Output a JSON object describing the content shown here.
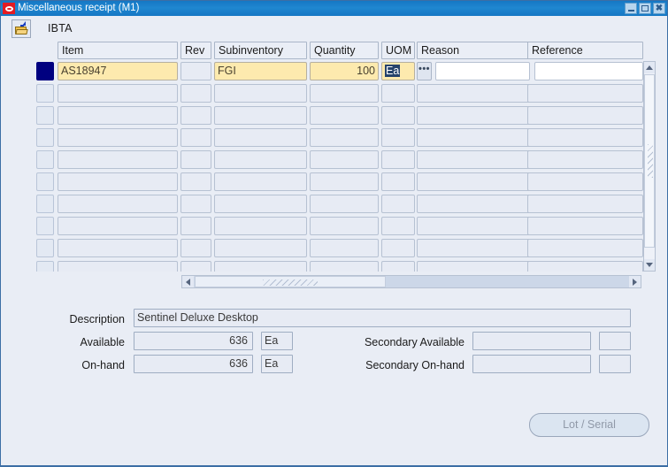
{
  "window": {
    "title": "Miscellaneous receipt (M1)",
    "logo_icon": "oracle-logo-icon",
    "controls": {
      "minimize": "minimize-icon",
      "maximize": "maximize-icon",
      "close": "✖"
    }
  },
  "toolbar": {
    "open_icon": "open-folder-icon",
    "org_code": "IBTA"
  },
  "grid": {
    "columns": [
      {
        "key": "item",
        "label": "Item"
      },
      {
        "key": "rev",
        "label": "Rev"
      },
      {
        "key": "subinventory",
        "label": "Subinventory"
      },
      {
        "key": "quantity",
        "label": "Quantity"
      },
      {
        "key": "uom",
        "label": "UOM"
      },
      {
        "key": "reason",
        "label": "Reason"
      },
      {
        "key": "reference",
        "label": "Reference"
      }
    ],
    "rows": [
      {
        "selected": true,
        "item": "AS18947",
        "rev": "",
        "subinventory": "FGI",
        "quantity": "100",
        "uom": "Ea",
        "uom_selected": true,
        "reason": "",
        "reference": ""
      },
      {
        "selected": false,
        "item": "",
        "rev": "",
        "subinventory": "",
        "quantity": "",
        "uom": "",
        "reason": "",
        "reference": ""
      },
      {
        "selected": false,
        "item": "",
        "rev": "",
        "subinventory": "",
        "quantity": "",
        "uom": "",
        "reason": "",
        "reference": ""
      },
      {
        "selected": false,
        "item": "",
        "rev": "",
        "subinventory": "",
        "quantity": "",
        "uom": "",
        "reason": "",
        "reference": ""
      },
      {
        "selected": false,
        "item": "",
        "rev": "",
        "subinventory": "",
        "quantity": "",
        "uom": "",
        "reason": "",
        "reference": ""
      },
      {
        "selected": false,
        "item": "",
        "rev": "",
        "subinventory": "",
        "quantity": "",
        "uom": "",
        "reason": "",
        "reference": ""
      },
      {
        "selected": false,
        "item": "",
        "rev": "",
        "subinventory": "",
        "quantity": "",
        "uom": "",
        "reason": "",
        "reference": ""
      },
      {
        "selected": false,
        "item": "",
        "rev": "",
        "subinventory": "",
        "quantity": "",
        "uom": "",
        "reason": "",
        "reference": ""
      },
      {
        "selected": false,
        "item": "",
        "rev": "",
        "subinventory": "",
        "quantity": "",
        "uom": "",
        "reason": "",
        "reference": ""
      },
      {
        "selected": false,
        "item": "",
        "rev": "",
        "subinventory": "",
        "quantity": "",
        "uom": "",
        "reason": "",
        "reference": ""
      }
    ],
    "lov_button_label": "•••"
  },
  "detail": {
    "description_label": "Description",
    "description_value": "Sentinel Deluxe Desktop",
    "available_label": "Available",
    "available_value": "636",
    "available_uom": "Ea",
    "onhand_label": "On-hand",
    "onhand_value": "636",
    "onhand_uom": "Ea",
    "secondary_available_label": "Secondary Available",
    "secondary_available_value": "",
    "secondary_available_uom": "",
    "secondary_onhand_label": "Secondary On-hand",
    "secondary_onhand_value": "",
    "secondary_onhand_uom": ""
  },
  "actions": {
    "lot_serial_label": "Lot / Serial"
  },
  "colors": {
    "titlebar": "#1577c4",
    "accent_red": "#e31b23",
    "active_row": "#000080",
    "editable_field": "#fdeaae",
    "background": "#e9edf5",
    "selection": "#26436b"
  }
}
